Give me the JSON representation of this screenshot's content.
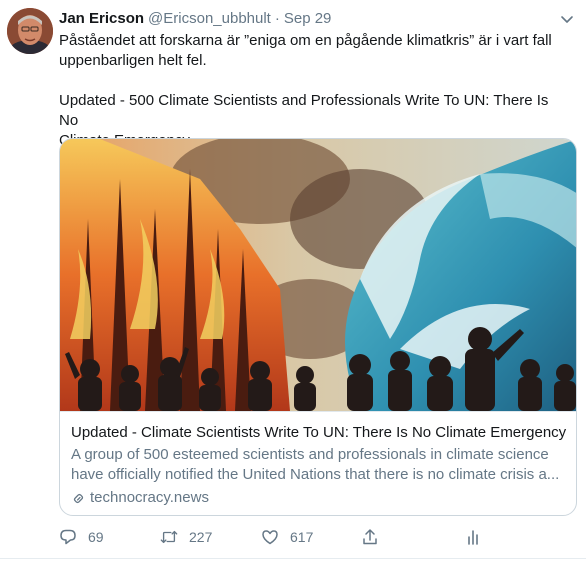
{
  "tweet": {
    "author_name": "Jan Ericson",
    "author_handle": "@Ericson_ubbhult",
    "separator": "·",
    "date": "Sep 29",
    "text_line1": "Påståendet att forskarna är ”eniga om en pågående klimatkris” är i vart fall",
    "text_line2": "uppenbarligen helt fel.",
    "text_line3": "Updated - 500 Climate Scientists and Professionals Write To UN: There Is No",
    "text_line4": "Climate Emergency"
  },
  "card": {
    "title": "Updated - Climate Scientists Write To UN: There Is No Climate Emergency",
    "desc_line1": "A group of 500 esteemed scientists and professionals in climate science",
    "desc_line2": "have officially notified the United Nations that there is no climate crisis a...",
    "domain": "technocracy.news"
  },
  "actions": {
    "reply_count": "69",
    "retweet_count": "227",
    "like_count": "617"
  },
  "icons": {
    "reply": "reply-icon",
    "retweet": "retweet-icon",
    "like": "heart-icon",
    "share": "share-icon",
    "analytics": "analytics-icon",
    "more": "chevron-down-icon",
    "link": "link-icon"
  },
  "colors": {
    "text_primary": "#14171a",
    "text_secondary": "#657786",
    "border": "#ccd6dd"
  }
}
